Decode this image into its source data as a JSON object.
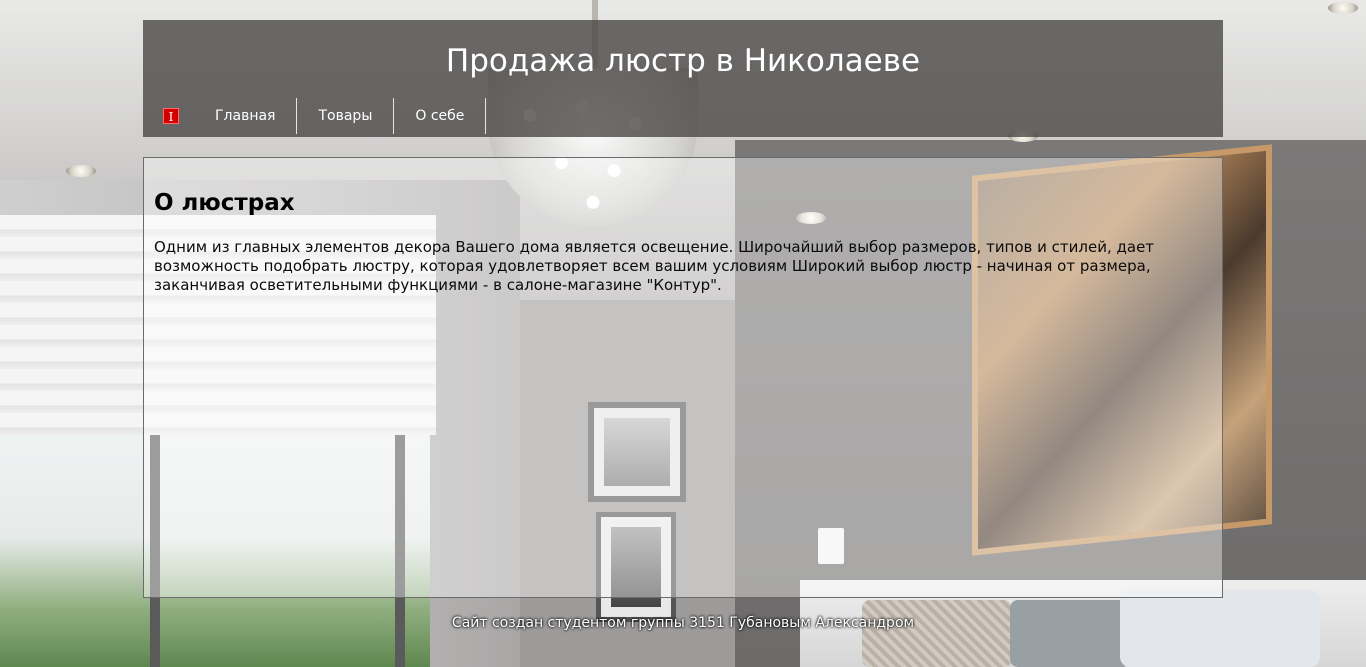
{
  "header": {
    "title": "Продажа люстр в Николаеве",
    "marker": "I",
    "nav": [
      "Главная",
      "Товары",
      "О себе"
    ]
  },
  "main": {
    "heading": "О люстрах",
    "paragraph": "Одним из главных элементов декора Вашего дома является освещение. Широчайший выбор размеров, типов и стилей, дает возможность подобрать люстру, которая удовлетворяет всем вашим условиям Широкий выбор люстр - начиная от размера, заканчивая осветительными функциями - в салоне-магазине \"Контур\"."
  },
  "footer": {
    "text": "Сайт создан студентом группы 3151 Губановым Александром"
  },
  "colors": {
    "header_bg": "#464442",
    "marker_red": "#d40000",
    "text_white": "#ffffff"
  }
}
